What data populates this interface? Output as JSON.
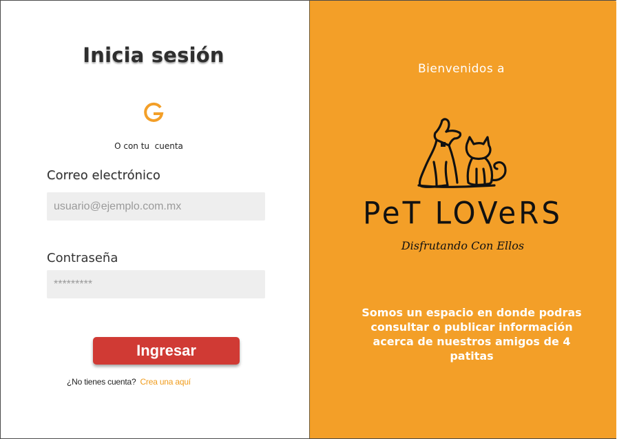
{
  "login": {
    "title": "Inicia sesión",
    "google_icon": "google-g-icon",
    "alt_text": "O con tu  cuenta",
    "email_label": "Correo electrónico",
    "email_placeholder": "usuario@ejemplo.com.mx",
    "email_value": "",
    "password_label": "Contraseña",
    "password_display": "*********",
    "submit_label": "Ingresar",
    "signup_question": "¿No tienes cuenta?",
    "signup_link": "Crea una aquí"
  },
  "welcome": {
    "heading": "Bienvenidos a",
    "brand_name": "PeT LOVeRS",
    "brand_tagline": "Disfrutando Con Ellos",
    "logo_icon": "dog-and-cat-icon",
    "description": "Somos un espacio en donde podras consultar o publicar información acerca de nuestros amigos de 4 patitas"
  },
  "colors": {
    "accent_orange": "#f39f28",
    "button_red": "#d03a34",
    "link_orange": "#f09b1a",
    "input_bg": "#eeeeee"
  }
}
